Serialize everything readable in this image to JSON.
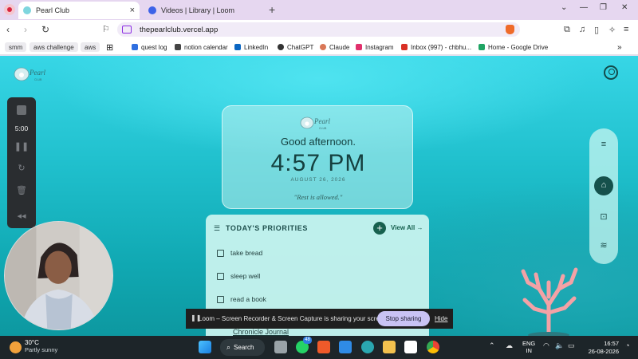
{
  "browser": {
    "tabs": [
      {
        "title": "Pearl Club",
        "active": true
      },
      {
        "title": "Videos | Library | Loom",
        "active": false
      }
    ],
    "url": "thepearlclub.vercel.app",
    "bookmarks": [
      {
        "label": "smm",
        "chip": true
      },
      {
        "label": "aws challenge",
        "chip": true
      },
      {
        "label": "aws",
        "chip": true
      },
      {
        "label": "quest log",
        "chip": false,
        "icon_color": "#2f6fe0"
      },
      {
        "label": "notion calendar",
        "chip": false,
        "icon_color": "#444444"
      },
      {
        "label": "LinkedIn",
        "chip": false,
        "icon_color": "#0a66c2"
      },
      {
        "label": "ChatGPT",
        "chip": false,
        "icon_color": "#333333"
      },
      {
        "label": "Claude",
        "chip": false,
        "icon_color": "#d97757"
      },
      {
        "label": "Instagram",
        "chip": false,
        "icon_color": "#e1306c"
      },
      {
        "label": "Inbox (997) - chbhu...",
        "chip": false,
        "icon_color": "#d93025"
      },
      {
        "label": "Home - Google Drive",
        "chip": false,
        "icon_color": "#1fa463"
      }
    ],
    "overflow_icon": "chevron-double-right-icon"
  },
  "app": {
    "brand_script": "Pearl",
    "brand_sub": "CLUB",
    "greeting": "Good afternoon.",
    "time": "4:57 PM",
    "date": "AUGUST 26, 2026",
    "quote": "\"Rest is allowed.\"",
    "priorities": {
      "title": "TODAY'S PRIORITIES",
      "view_all": "View All →",
      "items": [
        "take bread",
        "sleep well",
        "read a book"
      ],
      "peek_text": "Chronicle Journal"
    },
    "accent_color": "#17614f"
  },
  "loom": {
    "timer": "5:00",
    "share_message": "Loom – Screen Recorder & Screen Capture is sharing your screen.",
    "stop_label": "Stop sharing",
    "hide_label": "Hide"
  },
  "taskbar": {
    "weather_temp": "30°C",
    "weather_desc": "Partly sunny",
    "search_label": "Search",
    "whatsapp_badge": "48",
    "lang_line1": "ENG",
    "lang_line2": "IN",
    "clock_time": "16:57",
    "clock_date": "26-08-2026"
  }
}
